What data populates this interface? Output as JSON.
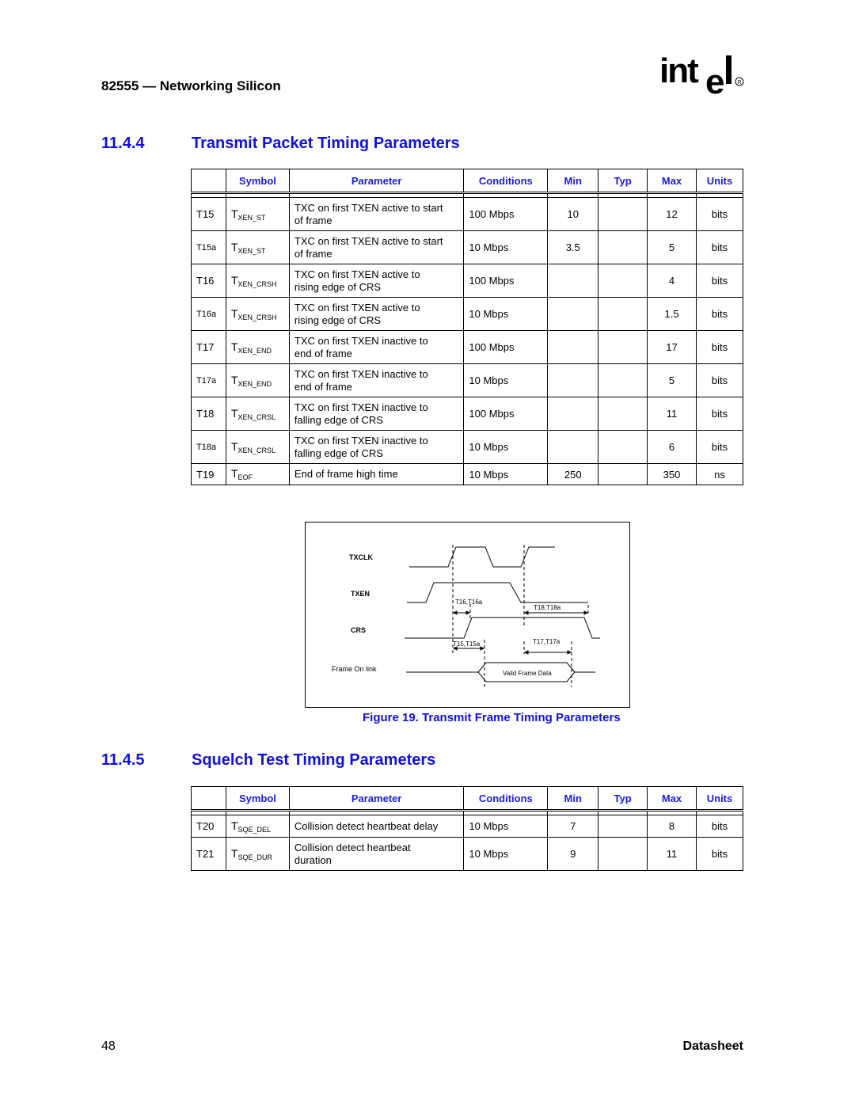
{
  "header": {
    "title": "82555 — Networking Silicon",
    "logo": "intel-logo"
  },
  "section_1": {
    "number": "11.4.4",
    "title": "Transmit Packet Timing Parameters",
    "columns": [
      "",
      "Symbol",
      "Parameter",
      "Conditions",
      "Min",
      "Typ",
      "Max",
      "Units"
    ],
    "rows": [
      {
        "id": "T15",
        "sym_main": "T",
        "sym_sub": "XEN_ST",
        "param": [
          "TXC on first TXEN active to start",
          "of frame"
        ],
        "cond": "100 Mbps",
        "min": "10",
        "typ": "",
        "max": "12",
        "units": "bits"
      },
      {
        "id": "T15a",
        "sym_main": "T",
        "sym_sub": "XEN_ST",
        "param": [
          "TXC on first TXEN active to start",
          "of frame"
        ],
        "cond": "10 Mbps",
        "min": "3.5",
        "typ": "",
        "max": "5",
        "units": "bits"
      },
      {
        "id": "T16",
        "sym_main": "T",
        "sym_sub": "XEN_CRSH",
        "param": [
          "TXC on first TXEN active to",
          "rising edge of CRS"
        ],
        "cond": "100 Mbps",
        "min": "",
        "typ": "",
        "max": "4",
        "units": "bits"
      },
      {
        "id": "T16a",
        "sym_main": "T",
        "sym_sub": "XEN_CRSH",
        "param": [
          "TXC on first TXEN active to",
          "rising edge of CRS"
        ],
        "cond": "10 Mbps",
        "min": "",
        "typ": "",
        "max": "1.5",
        "units": "bits"
      },
      {
        "id": "T17",
        "sym_main": "T",
        "sym_sub": "XEN_END",
        "param": [
          "TXC on first TXEN inactive to",
          "end of frame"
        ],
        "cond": "100 Mbps",
        "min": "",
        "typ": "",
        "max": "17",
        "units": "bits"
      },
      {
        "id": "T17a",
        "sym_main": "T",
        "sym_sub": "XEN_END",
        "param": [
          "TXC on first TXEN inactive to",
          "end of frame"
        ],
        "cond": "10 Mbps",
        "min": "",
        "typ": "",
        "max": "5",
        "units": "bits"
      },
      {
        "id": "T18",
        "sym_main": "T",
        "sym_sub": "XEN_CRSL",
        "param": [
          "TXC on first TXEN inactive to",
          "falling edge of CRS"
        ],
        "cond": "100 Mbps",
        "min": "",
        "typ": "",
        "max": "11",
        "units": "bits"
      },
      {
        "id": "T18a",
        "sym_main": "T",
        "sym_sub": "XEN_CRSL",
        "param": [
          "TXC on first TXEN inactive to",
          "falling edge of CRS"
        ],
        "cond": "10 Mbps",
        "min": "",
        "typ": "",
        "max": "6",
        "units": "bits"
      },
      {
        "id": "T19",
        "sym_main": "T",
        "sym_sub": "EOF",
        "param": [
          "End of frame high time",
          ""
        ],
        "cond": "10 Mbps",
        "min": "250",
        "typ": "",
        "max": "350",
        "units": "ns"
      }
    ]
  },
  "figure": {
    "caption": "Figure 19. Transmit Frame Timing Parameters",
    "signals": [
      "TXCLK",
      "TXEN",
      "CRS",
      "Frame On link"
    ],
    "annotations": [
      "T16,T16a",
      "T18,T18a",
      "T15,T15a",
      "T17,T17a",
      "Valid Frame Data"
    ]
  },
  "section_2": {
    "number": "11.4.5",
    "title": "Squelch Test Timing Parameters",
    "columns": [
      "",
      "Symbol",
      "Parameter",
      "Conditions",
      "Min",
      "Typ",
      "Max",
      "Units"
    ],
    "rows": [
      {
        "id": "T20",
        "sym_main": "T",
        "sym_sub": "SQE_DEL",
        "param": [
          "Collision detect heartbeat delay",
          ""
        ],
        "cond": "10 Mbps",
        "min": "7",
        "typ": "",
        "max": "8",
        "units": "bits"
      },
      {
        "id": "T21",
        "sym_main": "T",
        "sym_sub": "SQE_DUR",
        "param": [
          "Collision detect heartbeat",
          "duration"
        ],
        "cond": "10 Mbps",
        "min": "9",
        "typ": "",
        "max": "11",
        "units": "bits"
      }
    ]
  },
  "footer": {
    "page_number": "48",
    "doc_type": "Datasheet"
  }
}
